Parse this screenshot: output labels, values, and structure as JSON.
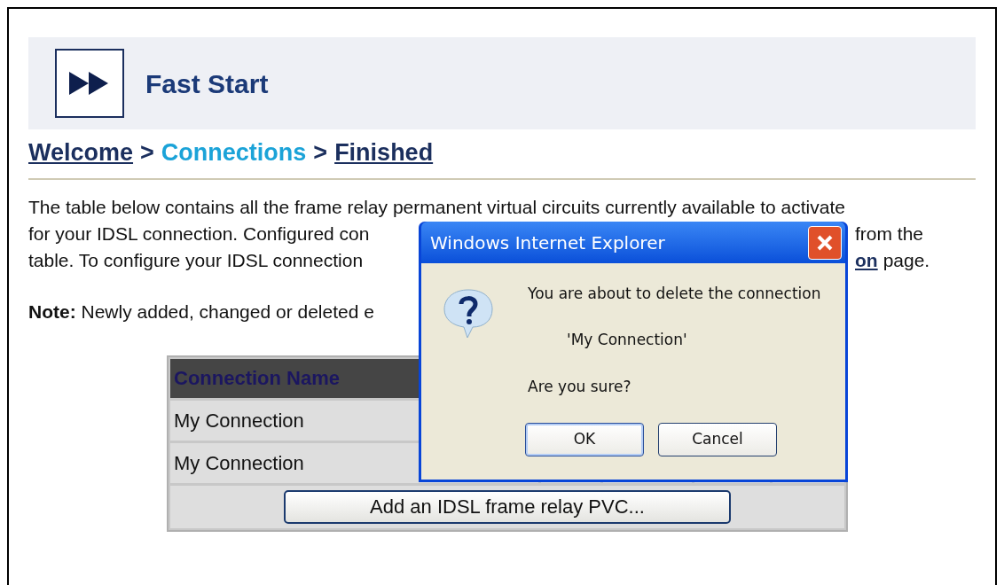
{
  "header": {
    "title": "Fast Start"
  },
  "breadcrumb": [
    {
      "label": "Welcome",
      "kind": "link"
    },
    {
      "label": ">",
      "kind": "separator"
    },
    {
      "label": "Connections",
      "kind": "current"
    },
    {
      "label": ">",
      "kind": "separator"
    },
    {
      "label": "Finished",
      "kind": "link"
    }
  ],
  "intro_lines": [
    {
      "left": "The table below contains all the frame relay permanent virtual circuits currently available to activate"
    },
    {
      "left": "for your IDSL connection. Configured con",
      "right": [
        {
          "text": "from the",
          "kind": "text"
        }
      ]
    },
    {
      "left": "table. To configure your IDSL connection",
      "right": [
        {
          "text": "on",
          "kind": "link"
        },
        {
          "text": "page.",
          "kind": "text"
        }
      ]
    }
  ],
  "note": "**Note:** Newly added, changed or deleted e",
  "table": {
    "columns": [
      "Connection Name"
    ],
    "rows": [
      [
        "My Connection"
      ],
      [
        "My Connection"
      ]
    ],
    "add_button": "Add an IDSL frame relay PVC..."
  },
  "dialog": {
    "title": "Windows Internet Explorer",
    "message": "You are about to delete the connection",
    "name": "'My Connection'",
    "question": "Are you sure?",
    "buttons": [
      {
        "label": "OK",
        "selected": true
      },
      {
        "label": "Cancel",
        "selected": false
      }
    ]
  }
}
